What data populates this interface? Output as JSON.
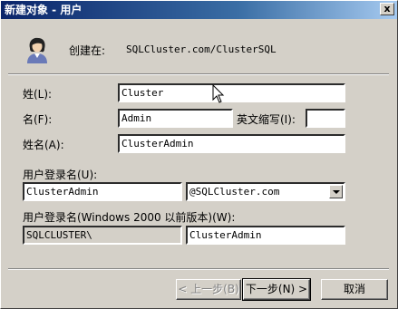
{
  "window": {
    "title": "新建对象 - 用户",
    "close_glyph": "x"
  },
  "header": {
    "create_in_label": "创建在:",
    "create_in_value": "SQLCluster.com/ClusterSQL"
  },
  "form": {
    "last_name": {
      "label": "姓(L):",
      "value": "Cluster"
    },
    "first_name": {
      "label": "名(F):",
      "value": "Admin"
    },
    "initials": {
      "label": "英文缩写(I):",
      "value": ""
    },
    "full_name": {
      "label": "姓名(A):",
      "value": "ClusterAdmin"
    },
    "logon_name": {
      "label": "用户登录名(U):",
      "value": "ClusterAdmin",
      "domain": "@SQLCluster.com"
    },
    "pre2000_logon": {
      "label": "用户登录名(Windows 2000 以前版本)(W):",
      "domain_prefix": "SQLCLUSTER\\",
      "value": "ClusterAdmin"
    }
  },
  "buttons": {
    "back": "< 上一步(B)",
    "next": "下一步(N) >",
    "cancel": "取消"
  }
}
